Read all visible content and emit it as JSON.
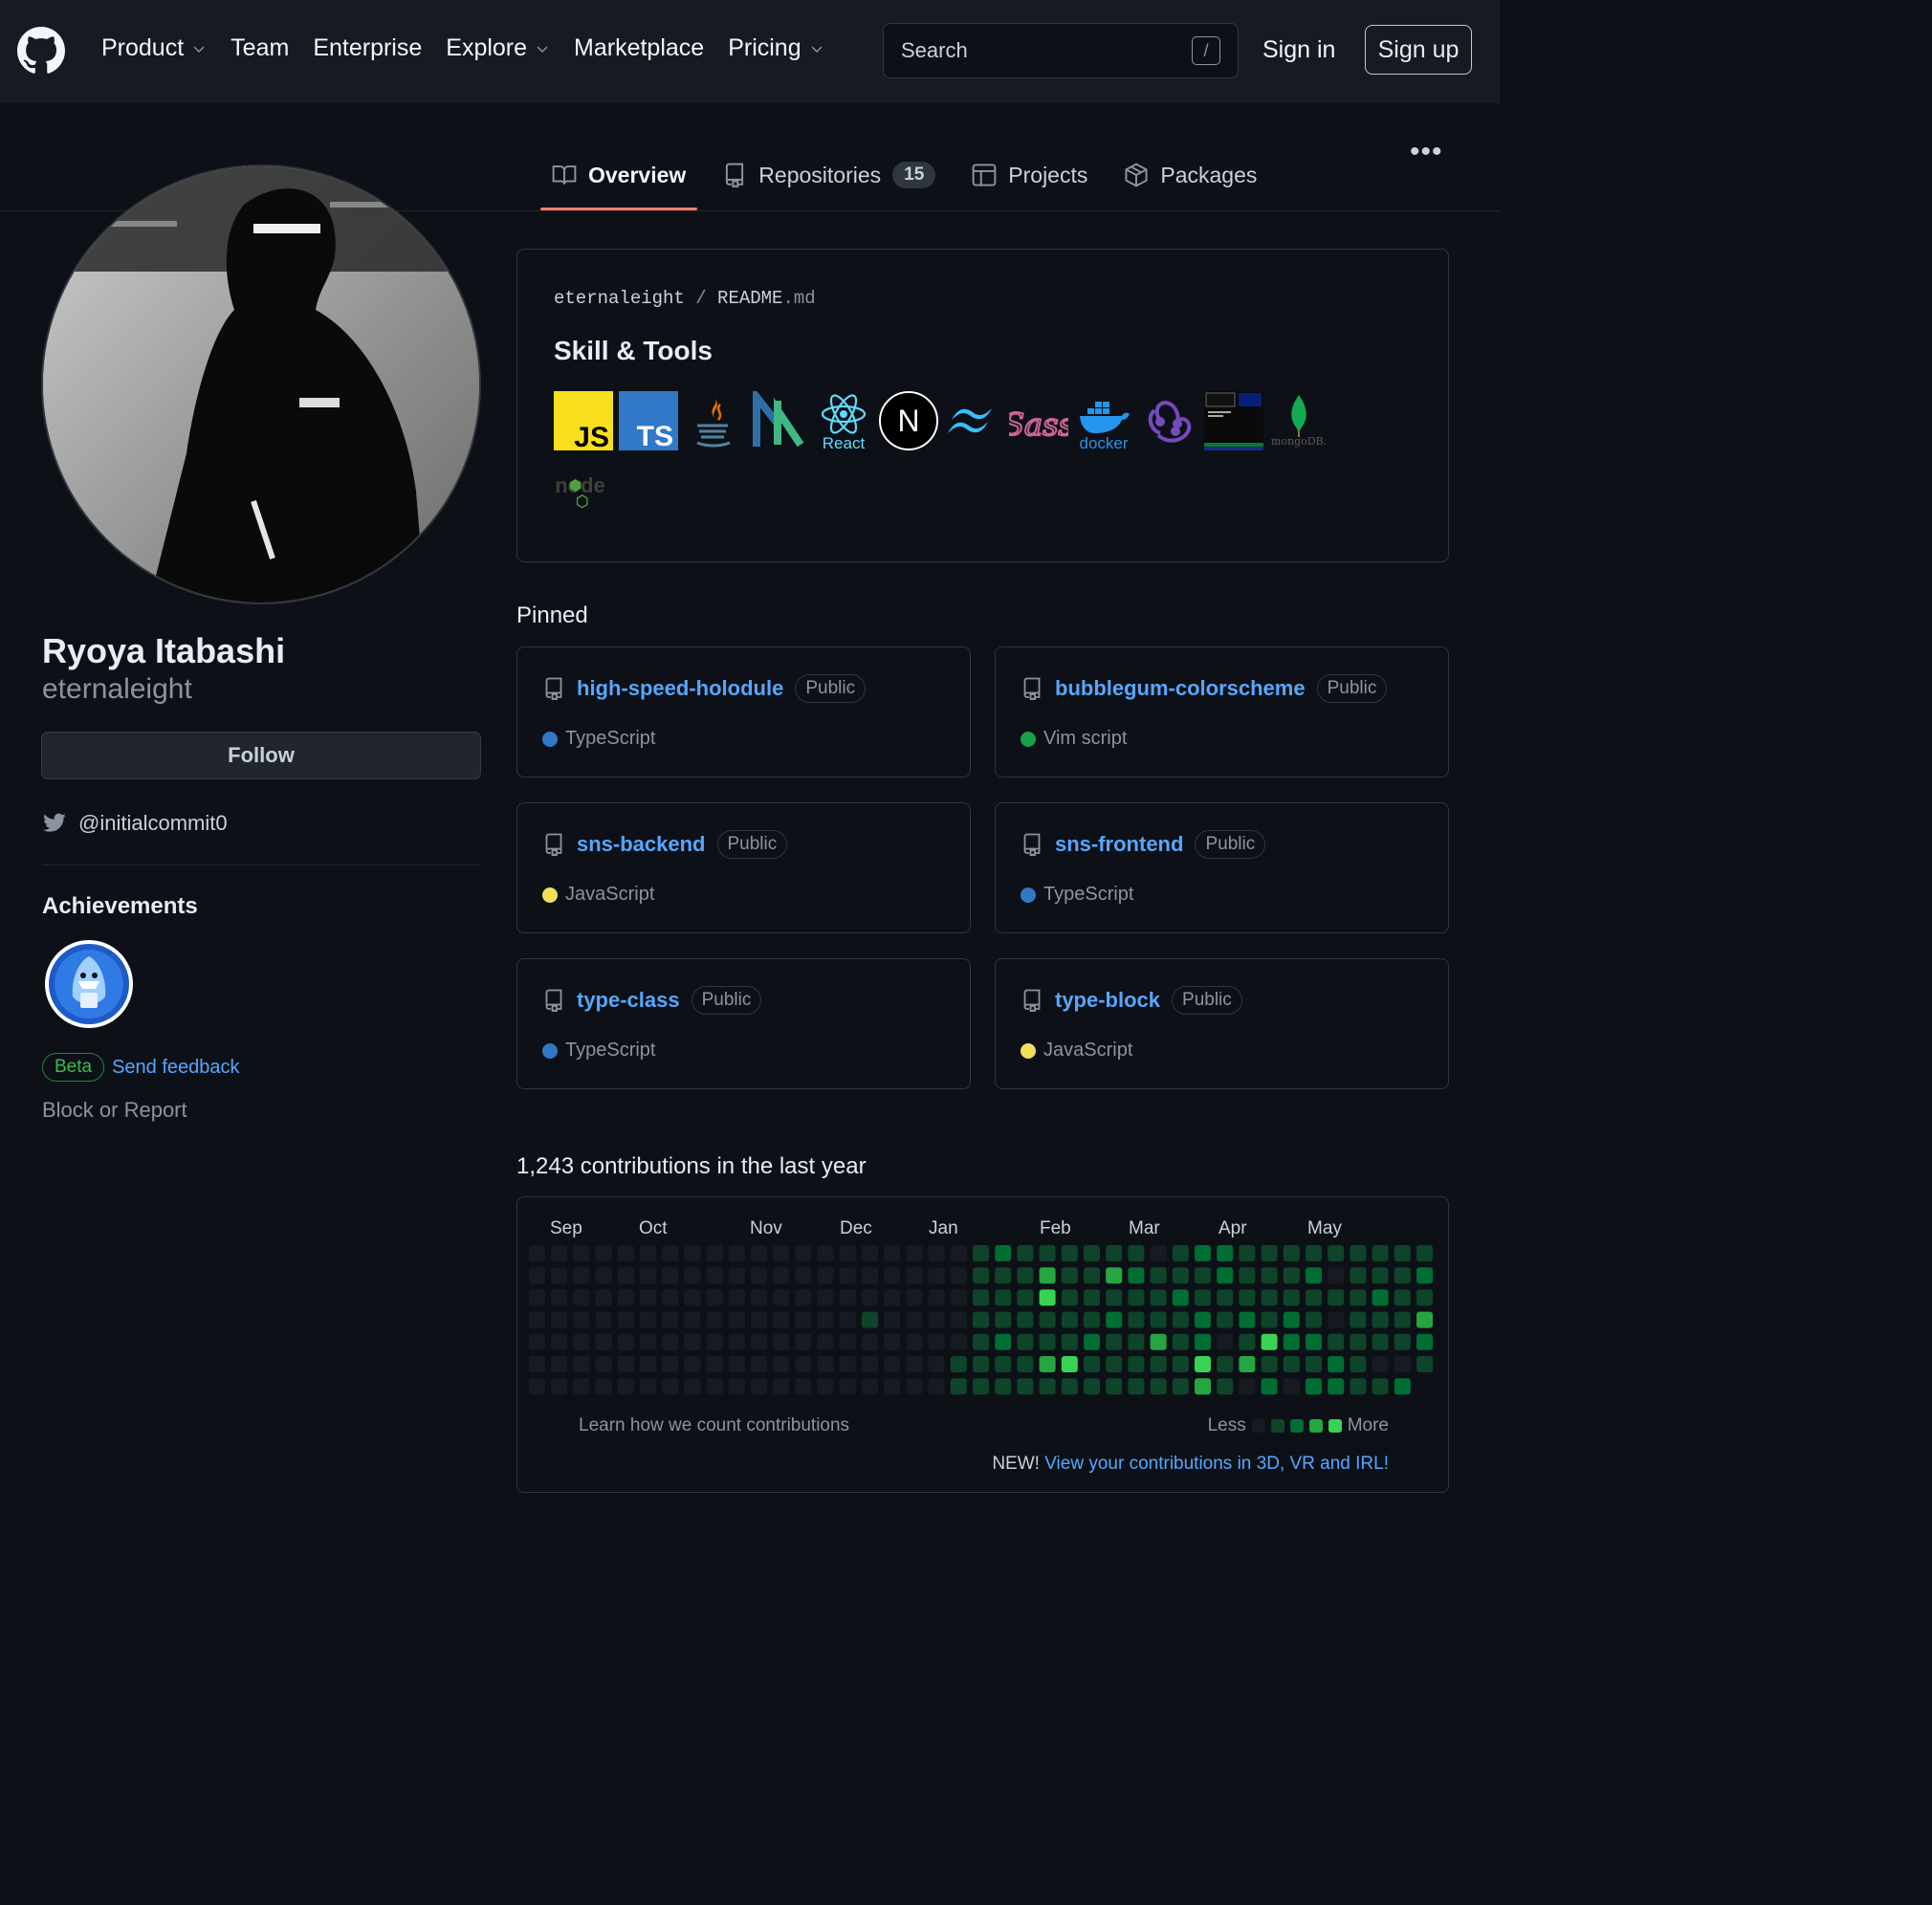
{
  "header": {
    "nav": [
      {
        "label": "Product",
        "dropdown": true
      },
      {
        "label": "Team",
        "dropdown": false
      },
      {
        "label": "Enterprise",
        "dropdown": false
      },
      {
        "label": "Explore",
        "dropdown": true
      },
      {
        "label": "Marketplace",
        "dropdown": false
      },
      {
        "label": "Pricing",
        "dropdown": true
      }
    ],
    "search_placeholder": "Search",
    "search_key": "/",
    "signin": "Sign in",
    "signup": "Sign up"
  },
  "tabs": [
    {
      "label": "Overview",
      "icon": "book-icon",
      "active": true
    },
    {
      "label": "Repositories",
      "icon": "repo-icon",
      "count": "15"
    },
    {
      "label": "Projects",
      "icon": "table-icon"
    },
    {
      "label": "Packages",
      "icon": "package-icon"
    }
  ],
  "profile": {
    "name": "Ryoya Itabashi",
    "login": "eternaleight",
    "follow": "Follow",
    "twitter": "@initialcommit0",
    "achievements_title": "Achievements",
    "beta": "Beta",
    "send_feedback": "Send feedback",
    "block": "Block or Report"
  },
  "readme": {
    "owner": "eternaleight",
    "separator": "/",
    "file": "README",
    "ext": ".md",
    "title": "Skill & Tools",
    "skills": [
      {
        "icon": "javascript-icon",
        "label": "JS"
      },
      {
        "icon": "typescript-icon",
        "label": "TS"
      },
      {
        "icon": "java-icon"
      },
      {
        "icon": "nuxt-icon"
      },
      {
        "icon": "react-icon",
        "label": "React"
      },
      {
        "icon": "nextjs-icon",
        "label": "N"
      },
      {
        "icon": "tailwind-icon"
      },
      {
        "icon": "sass-icon",
        "label": "Sass"
      },
      {
        "icon": "docker-icon",
        "label": "docker"
      },
      {
        "icon": "redux-icon"
      },
      {
        "icon": "terminal-icon"
      },
      {
        "icon": "mongodb-icon",
        "label": "mongoDB."
      },
      {
        "icon": "nodejs-icon",
        "label": "node"
      }
    ]
  },
  "pinned_title": "Pinned",
  "pinned": [
    {
      "name": "high-speed-holodule",
      "visibility": "Public",
      "language": "TypeScript",
      "color": "#3178c6"
    },
    {
      "name": "bubblegum-colorscheme",
      "visibility": "Public",
      "language": "Vim script",
      "color": "#199f4b"
    },
    {
      "name": "sns-backend",
      "visibility": "Public",
      "language": "JavaScript",
      "color": "#f1e05a"
    },
    {
      "name": "sns-frontend",
      "visibility": "Public",
      "language": "TypeScript",
      "color": "#3178c6"
    },
    {
      "name": "type-class",
      "visibility": "Public",
      "language": "TypeScript",
      "color": "#3178c6"
    },
    {
      "name": "type-block",
      "visibility": "Public",
      "language": "JavaScript",
      "color": "#f1e05a"
    }
  ],
  "contributions": {
    "title": "1,243 contributions in the last year",
    "months": [
      "Sep",
      "Oct",
      "Nov",
      "Dec",
      "Jan",
      "Feb",
      "Mar",
      "Apr",
      "May"
    ],
    "learn": "Learn how we count contributions",
    "less": "Less",
    "more": "More",
    "new_prefix": "NEW!",
    "new_link": "View your contributions in 3D, VR and IRL!",
    "colors": [
      "#161b22",
      "#0e4429",
      "#006d32",
      "#26a641",
      "#39d353"
    ]
  }
}
